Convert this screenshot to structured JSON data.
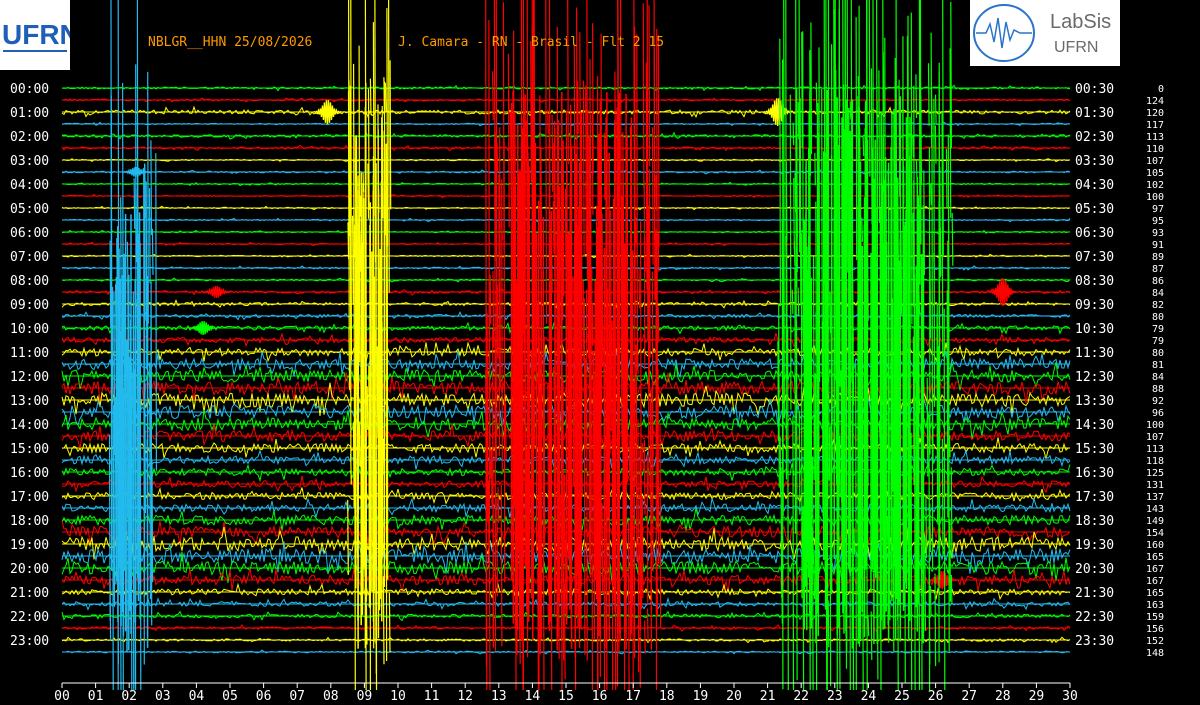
{
  "header": {
    "station_label": "NBLGR__HHN 25/08/2026",
    "operator_label": "J. Camara - RN - Brasil - Flt 2 15"
  },
  "logos": {
    "left_text": "UFRN",
    "right_title": "LabSis",
    "right_sub": "UFRN"
  },
  "colors": {
    "background": "#000000",
    "header_text": "#ff9a00",
    "axis_text": "#ffffff",
    "trace_cycle": [
      "#00ff00",
      "#ff0000",
      "#ffff00",
      "#22bbee"
    ]
  },
  "chart_data": {
    "type": "line",
    "title": "NBLGR__HHN 25/08/2026",
    "xlabel": "",
    "ylabel": "",
    "x_ticks": [
      "00",
      "01",
      "02",
      "03",
      "04",
      "05",
      "06",
      "07",
      "08",
      "09",
      "10",
      "11",
      "12",
      "13",
      "14",
      "15",
      "16",
      "17",
      "18",
      "19",
      "20",
      "21",
      "22",
      "23",
      "24",
      "25",
      "26",
      "27",
      "28",
      "29",
      "30"
    ],
    "xlim": [
      0,
      30
    ],
    "left_time_labels": [
      "00:00",
      "01:00",
      "02:00",
      "03:00",
      "04:00",
      "05:00",
      "06:00",
      "07:00",
      "08:00",
      "09:00",
      "10:00",
      "11:00",
      "12:00",
      "13:00",
      "14:00",
      "15:00",
      "16:00",
      "17:00",
      "18:00",
      "19:00",
      "20:00",
      "21:00",
      "22:00",
      "23:00"
    ],
    "right_time_labels": [
      "00:30",
      "01:30",
      "02:30",
      "03:30",
      "04:30",
      "05:30",
      "06:30",
      "07:30",
      "08:30",
      "09:30",
      "10:30",
      "11:30",
      "12:30",
      "13:30",
      "14:30",
      "15:30",
      "16:30",
      "17:30",
      "18:30",
      "19:30",
      "20:30",
      "21:30",
      "22:30",
      "23:30"
    ],
    "trace_scale_values": [
      0,
      124,
      120,
      117,
      113,
      110,
      107,
      105,
      102,
      100,
      97,
      95,
      93,
      91,
      89,
      87,
      86,
      84,
      82,
      80,
      79,
      79,
      80,
      81,
      84,
      88,
      92,
      96,
      100,
      107,
      113,
      118,
      125,
      131,
      137,
      143,
      149,
      154,
      160,
      165,
      167,
      167,
      165,
      163,
      159,
      156,
      152,
      148
    ],
    "noise_level_by_trace": [
      0.5,
      0.4,
      0.9,
      0.3,
      0.6,
      0.5,
      0.3,
      0.4,
      0.3,
      0.3,
      0.3,
      0.3,
      0.3,
      0.3,
      0.3,
      0.4,
      0.4,
      0.6,
      0.7,
      0.7,
      1.0,
      1.2,
      1.8,
      2.4,
      2.8,
      3.0,
      3.2,
      3.0,
      2.8,
      2.4,
      2.0,
      1.8,
      1.6,
      1.5,
      1.6,
      1.8,
      2.2,
      2.6,
      3.2,
      3.4,
      3.0,
      2.2,
      1.4,
      1.0,
      0.8,
      0.6,
      0.5,
      0.4
    ],
    "bursts": [
      {
        "x0": 8.5,
        "x1": 9.8,
        "color": "#ffff00",
        "trace_from": 1,
        "trace_to": 47
      },
      {
        "x0": 12.6,
        "x1": 17.8,
        "color": "#ff0000",
        "trace_from": 0,
        "trace_to": 47
      },
      {
        "x0": 21.3,
        "x1": 26.5,
        "color": "#00ff00",
        "trace_from": 0,
        "trace_to": 47
      },
      {
        "x0": 1.4,
        "x1": 2.8,
        "color": "#22bbee",
        "trace_from": 9,
        "trace_to": 47
      }
    ],
    "events": [
      {
        "x": 7.9,
        "trace": 2,
        "amp": 12
      },
      {
        "x": 21.3,
        "trace": 2,
        "amp": 14
      },
      {
        "x": 2.2,
        "trace": 7,
        "amp": 5
      },
      {
        "x": 4.6,
        "trace": 17,
        "amp": 6
      },
      {
        "x": 28.0,
        "trace": 17,
        "amp": 14
      },
      {
        "x": 4.2,
        "trace": 20,
        "amp": 7
      },
      {
        "x": 26.2,
        "trace": 41,
        "amp": 9
      }
    ]
  }
}
